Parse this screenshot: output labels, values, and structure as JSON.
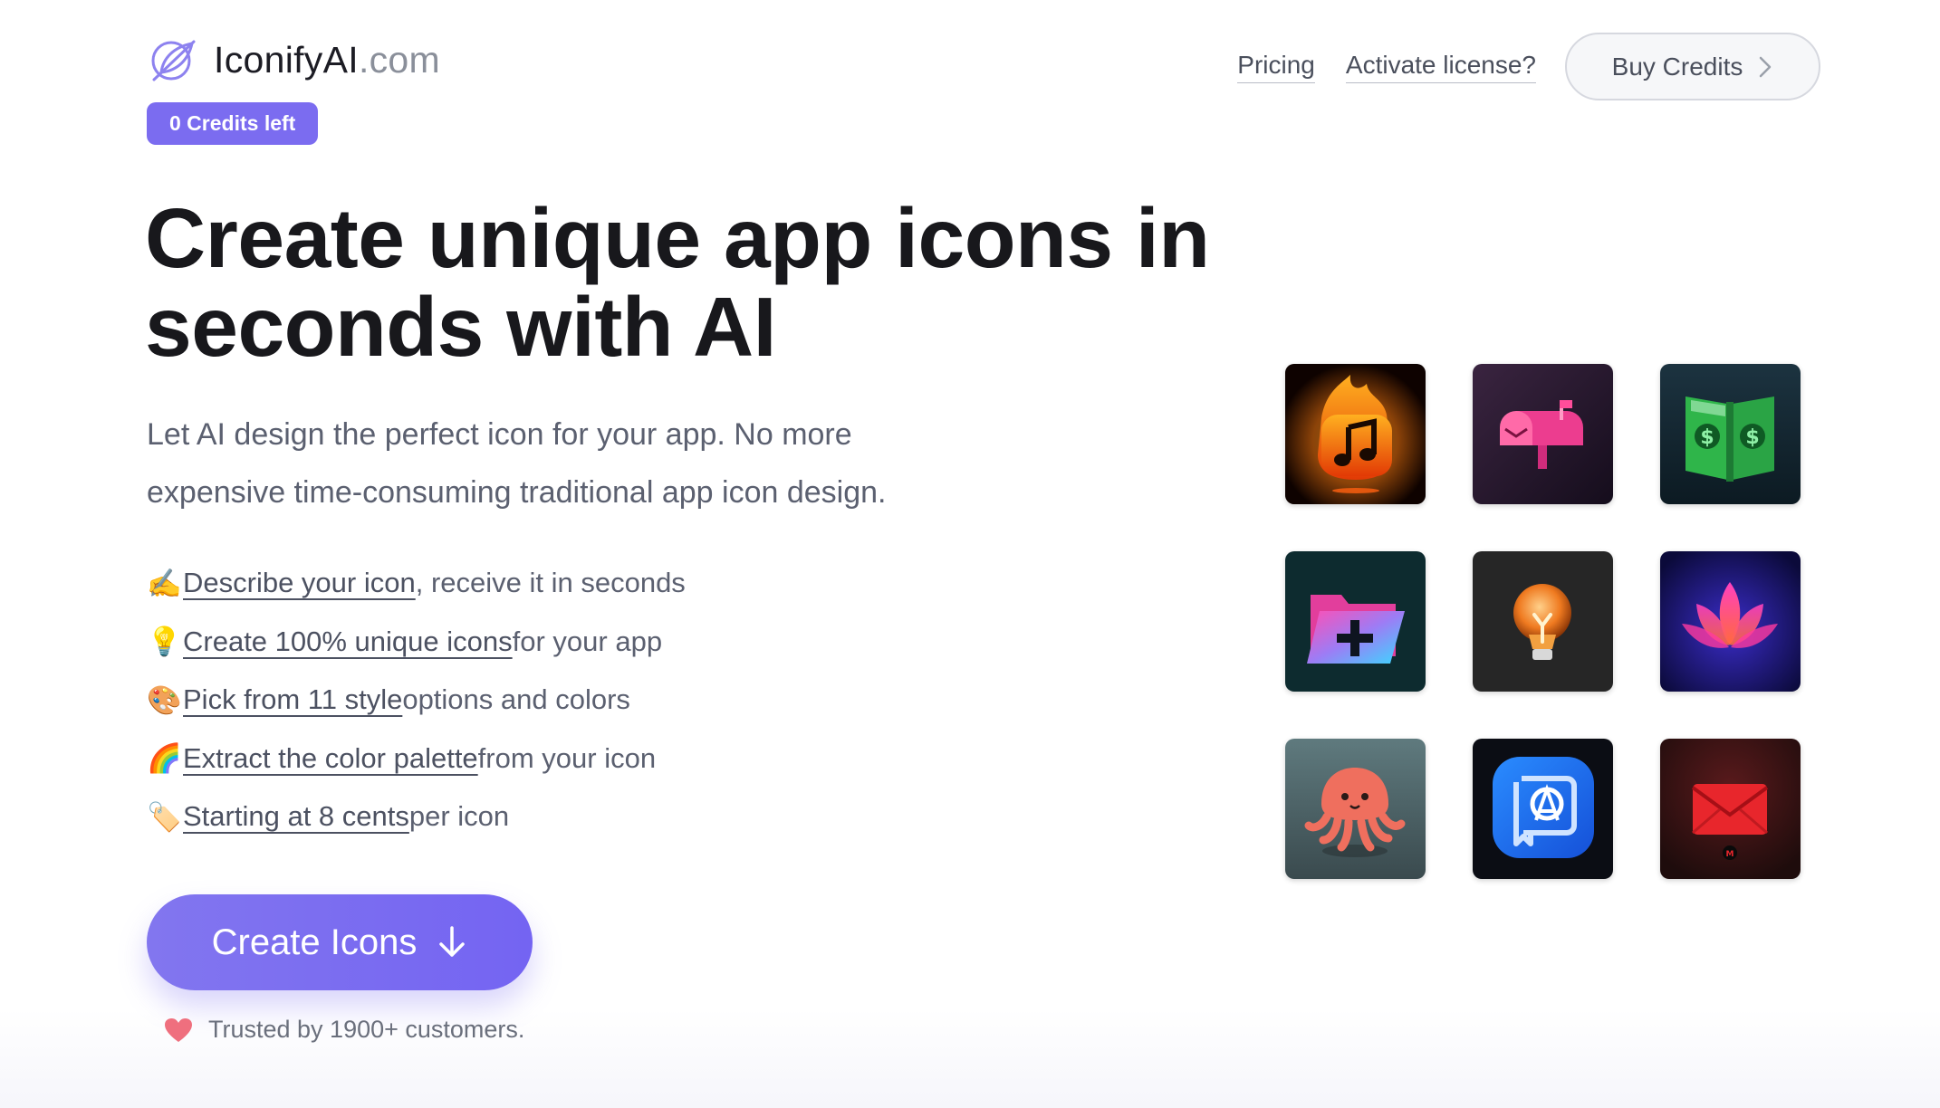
{
  "header": {
    "brand_name": "IconifyAI",
    "brand_domain": ".com",
    "credits_badge": "0 Credits left",
    "nav": {
      "pricing": "Pricing",
      "activate": "Activate license?",
      "buy_credits": "Buy Credits"
    }
  },
  "hero": {
    "headline_line1": "Create unique app icons in",
    "headline_line2": "seconds with AI",
    "subhead_line1": "Let AI design the perfect icon for your app. No more",
    "subhead_line2": "expensive time-consuming traditional app icon design.",
    "features": [
      {
        "emoji": "✍️",
        "link": "Describe your icon",
        "rest": ", receive it in seconds"
      },
      {
        "emoji": "💡",
        "link": "Create 100% unique icons",
        "rest": " for your app"
      },
      {
        "emoji": "🎨",
        "link": "Pick from 11 style",
        "rest": " options and colors"
      },
      {
        "emoji": "🌈",
        "link": "Extract the color palette",
        "rest": " from your icon"
      },
      {
        "emoji": "🏷️",
        "link": "Starting at 8 cents",
        "rest": " per icon"
      }
    ],
    "cta_label": "Create Icons",
    "trusted_text": "Trusted by 1900+ customers."
  },
  "showcase": {
    "icons": [
      "music-flame-icon",
      "mailbox-icon",
      "money-book-icon",
      "folder-plus-icon",
      "lightbulb-icon",
      "lotus-icon",
      "jellyfish-icon",
      "app-store-icon",
      "envelope-icon"
    ]
  },
  "colors": {
    "accent": "#7b6cf0",
    "text_dark": "#18181c",
    "text_muted": "#5b6070",
    "heart": "#ef6f7e"
  }
}
